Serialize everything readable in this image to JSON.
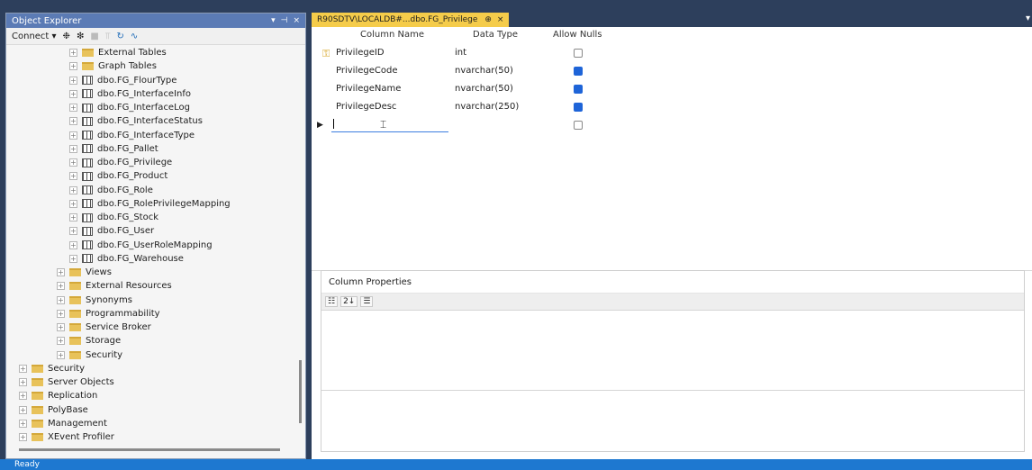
{
  "object_explorer": {
    "title": "Object Explorer",
    "title_controls": [
      "▾",
      "⊣",
      "×"
    ],
    "toolbar": {
      "connect_label": "Connect ▾",
      "icons": [
        "connect-icon",
        "disconnect-icon",
        "stop-icon",
        "filter-icon",
        "refresh-icon",
        "activity-monitor-icon"
      ]
    },
    "tree": [
      {
        "label": "External Tables",
        "icon": "folder"
      },
      {
        "label": "Graph Tables",
        "icon": "folder"
      },
      {
        "label": "dbo.FG_FlourType",
        "icon": "table"
      },
      {
        "label": "dbo.FG_InterfaceInfo",
        "icon": "table"
      },
      {
        "label": "dbo.FG_InterfaceLog",
        "icon": "table"
      },
      {
        "label": "dbo.FG_InterfaceStatus",
        "icon": "table"
      },
      {
        "label": "dbo.FG_InterfaceType",
        "icon": "table"
      },
      {
        "label": "dbo.FG_Pallet",
        "icon": "table"
      },
      {
        "label": "dbo.FG_Privilege",
        "icon": "table"
      },
      {
        "label": "dbo.FG_Product",
        "icon": "table"
      },
      {
        "label": "dbo.FG_Role",
        "icon": "table"
      },
      {
        "label": "dbo.FG_RolePrivilegeMapping",
        "icon": "table"
      },
      {
        "label": "dbo.FG_Stock",
        "icon": "table"
      },
      {
        "label": "dbo.FG_User",
        "icon": "table"
      },
      {
        "label": "dbo.FG_UserRoleMapping",
        "icon": "table"
      },
      {
        "label": "dbo.FG_Warehouse",
        "icon": "table"
      },
      {
        "label": "Views",
        "icon": "folder"
      },
      {
        "label": "External Resources",
        "icon": "folder"
      },
      {
        "label": "Synonyms",
        "icon": "folder"
      },
      {
        "label": "Programmability",
        "icon": "folder"
      },
      {
        "label": "Service Broker",
        "icon": "folder"
      },
      {
        "label": "Storage",
        "icon": "folder"
      },
      {
        "label": "Security",
        "icon": "folder"
      },
      {
        "label": "Security",
        "icon": "folder"
      },
      {
        "label": "Server Objects",
        "icon": "folder"
      },
      {
        "label": "Replication",
        "icon": "folder"
      },
      {
        "label": "PolyBase",
        "icon": "folder"
      },
      {
        "label": "Management",
        "icon": "folder"
      },
      {
        "label": "XEvent Profiler",
        "icon": "folder"
      }
    ]
  },
  "document": {
    "tab": {
      "label": "R90SDTV\\LOCALDB#...dbo.FG_Privilege",
      "pin": "⊕",
      "close": "×"
    },
    "headers": {
      "column_name": "Column Name",
      "data_type": "Data Type",
      "allow_nulls": "Allow Nulls"
    },
    "rows": [
      {
        "name": "PrivilegeID",
        "type": "int",
        "allow_nulls": false,
        "primary_key": true
      },
      {
        "name": "PrivilegeCode",
        "type": "nvarchar(50)",
        "allow_nulls": true
      },
      {
        "name": "PrivilegeName",
        "type": "nvarchar(50)",
        "allow_nulls": true
      },
      {
        "name": "PrivilegeDesc",
        "type": "nvarchar(250)",
        "allow_nulls": true
      }
    ],
    "column_properties": {
      "title": "Column Properties",
      "toolbar": [
        "categorized-icon",
        "alphabetical-icon",
        "property-pages-icon"
      ]
    }
  },
  "status_bar": {
    "text": "Ready"
  }
}
